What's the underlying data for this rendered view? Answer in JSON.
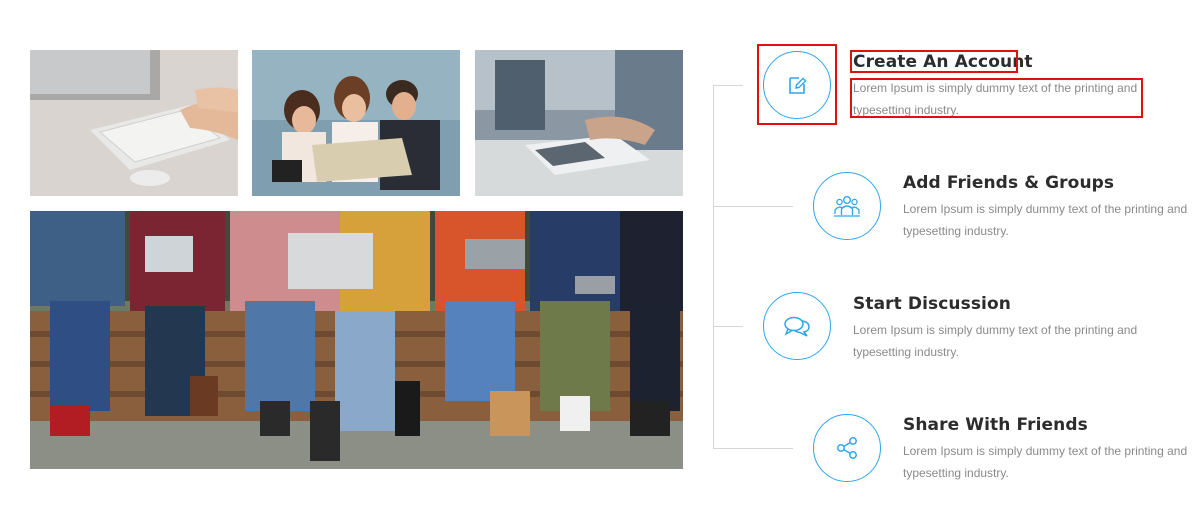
{
  "photos": [
    {
      "alt": "laptop-keyboard-photo"
    },
    {
      "alt": "friends-with-map-photo"
    },
    {
      "alt": "office-team-photo"
    },
    {
      "alt": "group-with-devices-photo"
    }
  ],
  "features": [
    {
      "title": "Create An Account",
      "desc": "Lorem Ipsum is simply dummy text of the printing and typesetting industry.",
      "icon": "edit-icon"
    },
    {
      "title": "Add Friends & Groups",
      "desc": "Lorem Ipsum is simply dummy text of the printing and typesetting industry.",
      "icon": "group-icon"
    },
    {
      "title": "Start Discussion",
      "desc": "Lorem Ipsum is simply dummy text of the printing and typesetting industry.",
      "icon": "chat-bubbles-icon"
    },
    {
      "title": "Share With Friends",
      "desc": "Lorem Ipsum is simply dummy text of the printing and typesetting industry.",
      "icon": "share-icon"
    }
  ],
  "colors": {
    "accent": "#2fa6ea",
    "highlight": "#e01010",
    "title": "#2c2c2c",
    "text": "#8a8a8a"
  }
}
